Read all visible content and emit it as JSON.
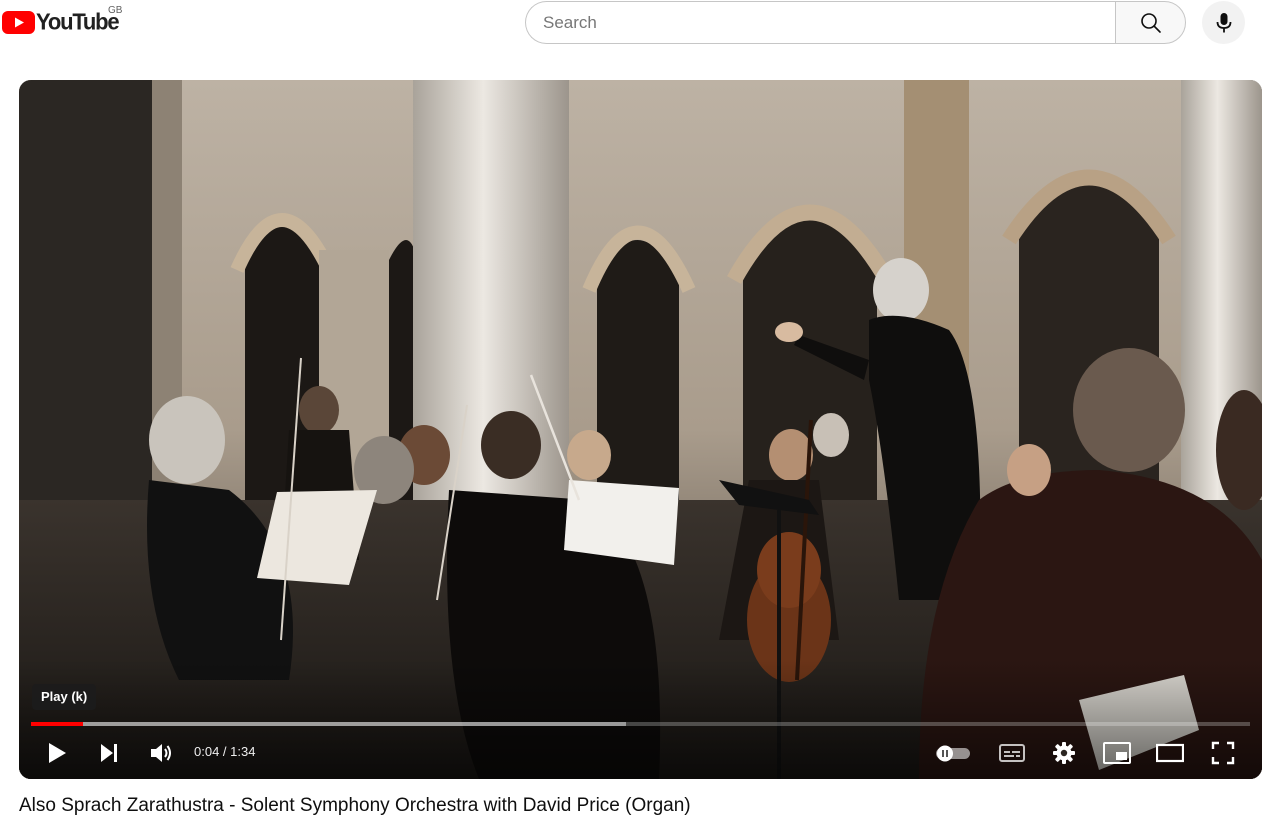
{
  "header": {
    "logo_text": "YouTube",
    "country_code": "GB",
    "brand_color": "#ff0000",
    "search_placeholder": "Search",
    "search_icon": "search-icon",
    "mic_icon": "microphone-icon"
  },
  "player": {
    "tooltip": "Play (k)",
    "current_time": "0:04",
    "separator": " / ",
    "duration": "1:34",
    "played_fraction": 0.043,
    "buffered_fraction": 0.488,
    "controls": [
      "play-icon",
      "next-icon",
      "volume-icon",
      "autoplay-toggle-icon",
      "subtitles-icon",
      "settings-icon",
      "miniplayer-icon",
      "theater-mode-icon",
      "fullscreen-icon"
    ],
    "progress_color": "#ff0000"
  },
  "video": {
    "title": "Also Sprach Zarathustra - Solent Symphony Orchestra with David Price (Organ)"
  }
}
